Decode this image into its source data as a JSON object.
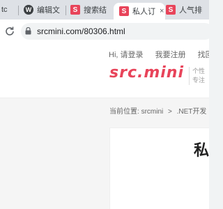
{
  "browser": {
    "tabs": [
      {
        "title": "tc",
        "favicon": "doc-icon",
        "active": false
      },
      {
        "title": "编辑文",
        "favicon": "wordpress-icon",
        "active": false
      },
      {
        "title": "搜索结",
        "favicon": "s-icon",
        "active": false
      },
      {
        "title": "私人订",
        "favicon": "s-icon",
        "active": true
      },
      {
        "title": "人气排",
        "favicon": "s-icon",
        "active": false
      }
    ],
    "close_glyph": "×",
    "url": "srcmini.com/80306.html"
  },
  "site": {
    "top_links": {
      "greeting": "Hi, 请登录",
      "register": "我要注册",
      "find": "找回"
    },
    "logo_text": "src.mini",
    "slogan_line1": "个性",
    "slogan_line2": "专注",
    "breadcrumb": {
      "prefix": "当前位置:",
      "home": "srcmini",
      "sep": ">",
      "category": ".NET开发",
      "more": ">"
    },
    "article_title_fragment": "私"
  },
  "colors": {
    "brand": "#e8445a",
    "tabbar": "#dee1e6"
  }
}
